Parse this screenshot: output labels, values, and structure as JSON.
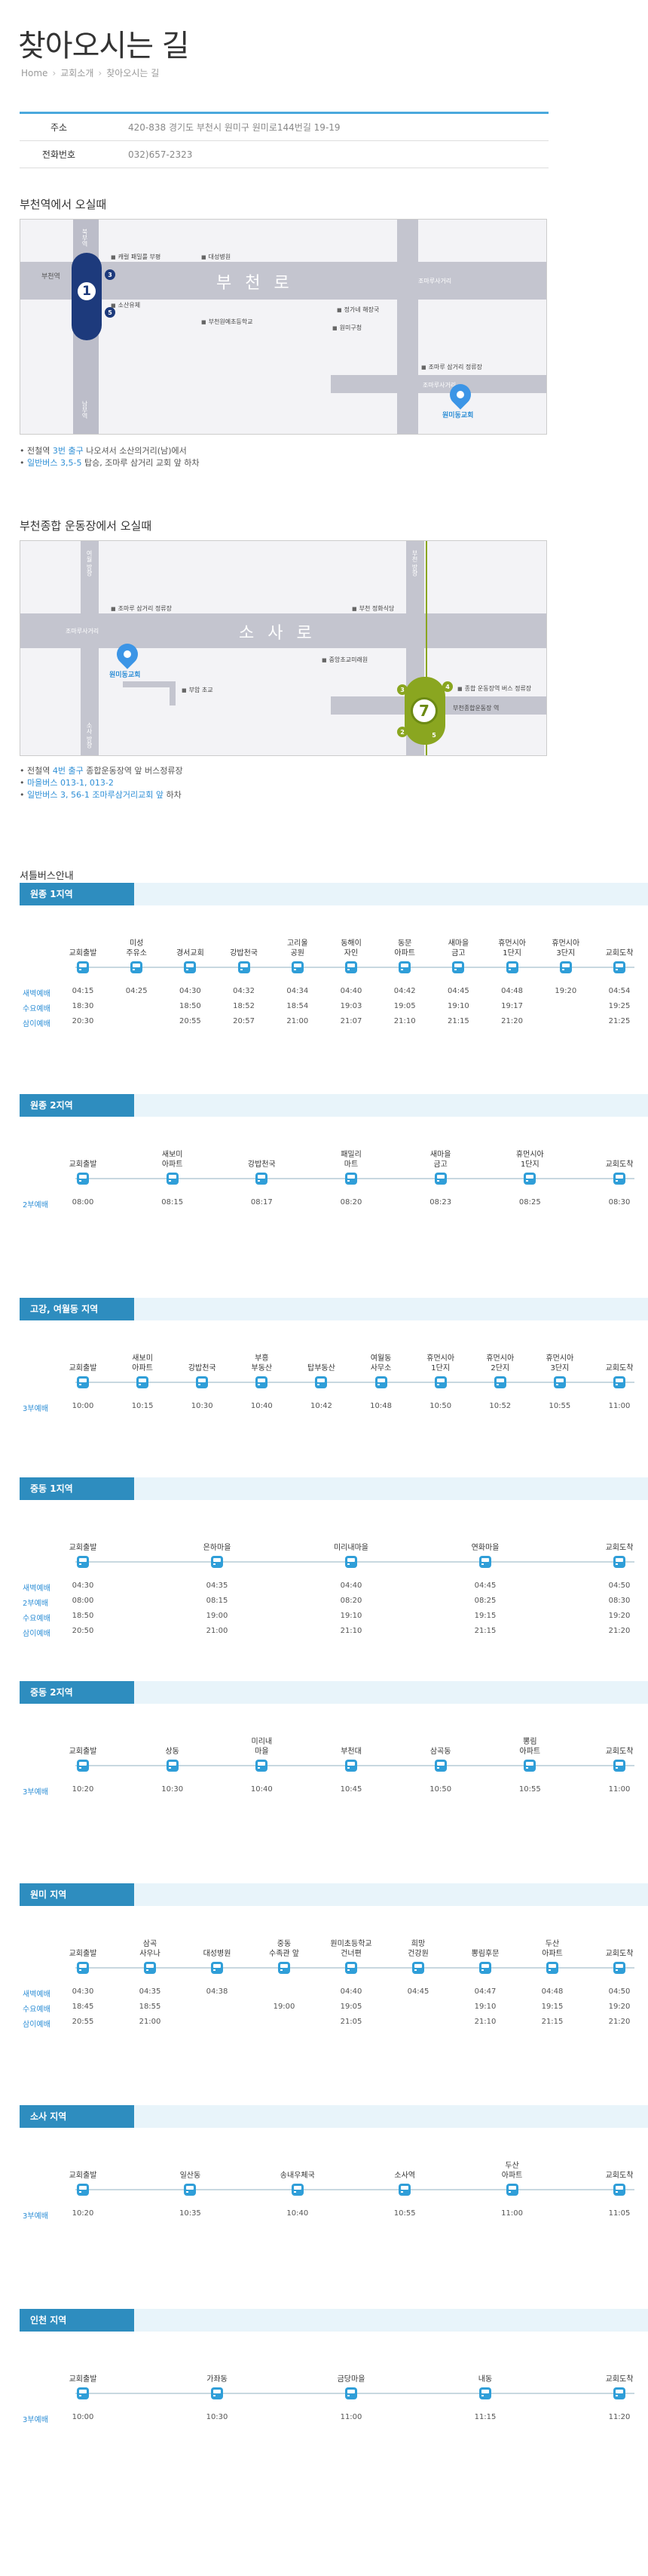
{
  "page": {
    "title": "찾아오시는 길",
    "breadcrumb": [
      "Home",
      "교회소개",
      "찾아오시는 길"
    ]
  },
  "info": {
    "rows": [
      {
        "label": "주소",
        "value": "420-838 경기도 부천시 원미구 원미로144번길 19-19"
      },
      {
        "label": "전화번호",
        "value": "032)657-2323"
      }
    ]
  },
  "map1": {
    "heading": "부천역에서 오실때",
    "road_name": "부천로",
    "station_number": "1",
    "labels": {
      "bucheon_station": "부천역",
      "exit3": "3",
      "exit5": "5",
      "north_station": "북부역",
      "south_station": "남부역",
      "crossroad": "조마루 사거리",
      "crossroad2": "조마루사거리",
      "church": "원미동교회"
    },
    "pois": [
      "캐럴 패밀룰 부평",
      "대성병원",
      "소산유체",
      "부천원예초등학교",
      "정가네 해장국",
      "원미구청",
      "조마루 삼거리 정류장"
    ],
    "bullets": [
      {
        "pre": "전철역 ",
        "hl": "3번 출구",
        "post": " 나오셔서 소산의거리(남)에서"
      },
      {
        "pre": "",
        "hl": "일반버스 3,5-5",
        "post": " 탑승, 조마루 삼거리 교회 앞 하차"
      }
    ]
  },
  "map2": {
    "heading": "부천종합 운동장에서 오실때",
    "road_name": "소사로",
    "station_number": "7",
    "labels": {
      "crossroad": "조마루사거리",
      "church": "원미동교회",
      "ex3": "3",
      "ex4": "4",
      "ex2": "2",
      "ex5": "5",
      "stadium": "부천종합운동장 역",
      "north_label": "부천 방향",
      "south_label": "소사 방향",
      "north_label2": "여월 방향"
    },
    "pois": [
      "조마루 삼거리 정류장",
      "부천 정화식당",
      "중앙초교미래원",
      "부암 초교",
      "종합 운동장역 버스 정류장"
    ],
    "bullets": [
      {
        "pre": "전철역 ",
        "hl": "4번 출구",
        "post": " 종합운동장역 앞 버스정류장"
      },
      {
        "pre": "",
        "hl": "마을버스 013-1, 013-2",
        "post": ""
      },
      {
        "pre": "",
        "hl": "일반버스 3, 56-1 조마루삼거리교회 앞",
        "post": " 하차"
      }
    ]
  },
  "shuttle_heading": "셔틀버스안내",
  "routes": [
    {
      "name": "원종 1지역",
      "stops": [
        "교회출발",
        "미성\n주유소",
        "경서교회",
        "강밥천국",
        "고리울\n공원",
        "동해이\n자인",
        "동문\n아파트",
        "새마을\n금고",
        "휴먼시아\n1단지",
        "휴먼시아\n3단지",
        "교회도착"
      ],
      "rows": [
        {
          "label": "새벽예배",
          "times": [
            "04:15",
            "04:25",
            "04:30",
            "04:32",
            "04:34",
            "04:40",
            "04:42",
            "04:45",
            "04:48",
            "19:20",
            "04:54"
          ]
        },
        {
          "label": "수요예배",
          "times": [
            "18:30",
            "",
            "18:50",
            "18:52",
            "18:54",
            "19:03",
            "19:05",
            "19:10",
            "19:17",
            "",
            "19:25"
          ]
        },
        {
          "label": "삼이예배",
          "times": [
            "20:30",
            "",
            "20:55",
            "20:57",
            "21:00",
            "21:07",
            "21:10",
            "21:15",
            "21:20",
            "",
            "21:25"
          ]
        }
      ]
    },
    {
      "name": "원종 2지역",
      "stops": [
        "교회출발",
        "새보미\n아파트",
        "강밥천국",
        "패밀리\n마트",
        "새마을\n금고",
        "휴먼시아\n1단지",
        "교회도착"
      ],
      "rows": [
        {
          "label": "2부예배",
          "times": [
            "08:00",
            "08:15",
            "08:17",
            "08:20",
            "08:23",
            "08:25",
            "08:30"
          ]
        }
      ]
    },
    {
      "name": "고강, 여월동 지역",
      "stops": [
        "교회출발",
        "새보미\n아파트",
        "강밥천국",
        "부흥\n부동산",
        "탑부동산",
        "여월동\n사무소",
        "휴먼시아\n1단지",
        "휴먼시아\n2단지",
        "휴먼시아\n3단지",
        "교회도착"
      ],
      "rows": [
        {
          "label": "3부예배",
          "times": [
            "10:00",
            "10:15",
            "10:30",
            "10:40",
            "10:42",
            "10:48",
            "10:50",
            "10:52",
            "10:55",
            "11:00"
          ]
        }
      ]
    },
    {
      "name": "중동 1지역",
      "stops": [
        "교회출발",
        "은하마을",
        "미리내마을",
        "연화마을",
        "교회도착"
      ],
      "rows": [
        {
          "label": "새벽예배",
          "times": [
            "04:30",
            "04:35",
            "04:40",
            "04:45",
            "04:50"
          ]
        },
        {
          "label": "2부예배",
          "times": [
            "08:00",
            "08:15",
            "08:20",
            "08:25",
            "08:30"
          ]
        },
        {
          "label": "수요예배",
          "times": [
            "18:50",
            "19:00",
            "19:10",
            "19:15",
            "19:20"
          ]
        },
        {
          "label": "삼이예배",
          "times": [
            "20:50",
            "21:00",
            "21:10",
            "21:15",
            "21:20"
          ]
        }
      ]
    },
    {
      "name": "중동 2지역",
      "stops": [
        "교회출발",
        "상동",
        "미리내\n마을",
        "부천대",
        "삼곡동",
        "뽕림\n아파트",
        "교회도착"
      ],
      "rows": [
        {
          "label": "3부예배",
          "times": [
            "10:20",
            "10:30",
            "10:40",
            "10:45",
            "10:50",
            "10:55",
            "11:00"
          ]
        }
      ]
    },
    {
      "name": "원미 지역",
      "stops": [
        "교회출발",
        "삼곡\n사우나",
        "대성병원",
        "중동\n수족관 앞",
        "원미초등학교\n건너편",
        "희망\n건강원",
        "뽕림후문",
        "두산\n아파트",
        "교회도착"
      ],
      "rows": [
        {
          "label": "새벽예배",
          "times": [
            "04:30",
            "04:35",
            "04:38",
            "",
            "04:40",
            "04:45",
            "04:47",
            "04:48",
            "04:50"
          ]
        },
        {
          "label": "수요예배",
          "times": [
            "18:45",
            "18:55",
            "",
            "19:00",
            "19:05",
            "",
            "19:10",
            "19:15",
            "19:20"
          ]
        },
        {
          "label": "삼이예배",
          "times": [
            "20:55",
            "21:00",
            "",
            "",
            "21:05",
            "",
            "21:10",
            "21:15",
            "21:20"
          ]
        }
      ]
    },
    {
      "name": "소사 지역",
      "stops": [
        "교회출발",
        "일산동",
        "송내우체국",
        "소사역",
        "두산\n아파트",
        "교회도착"
      ],
      "rows": [
        {
          "label": "3부예배",
          "times": [
            "10:20",
            "10:35",
            "10:40",
            "10:55",
            "11:00",
            "11:05"
          ]
        }
      ]
    },
    {
      "name": "인천 지역",
      "stops": [
        "교회출발",
        "가좌동",
        "금당마을",
        "내동",
        "교회도착"
      ],
      "rows": [
        {
          "label": "3부예배",
          "times": [
            "10:00",
            "10:30",
            "11:00",
            "11:15",
            "11:20"
          ]
        }
      ]
    }
  ]
}
